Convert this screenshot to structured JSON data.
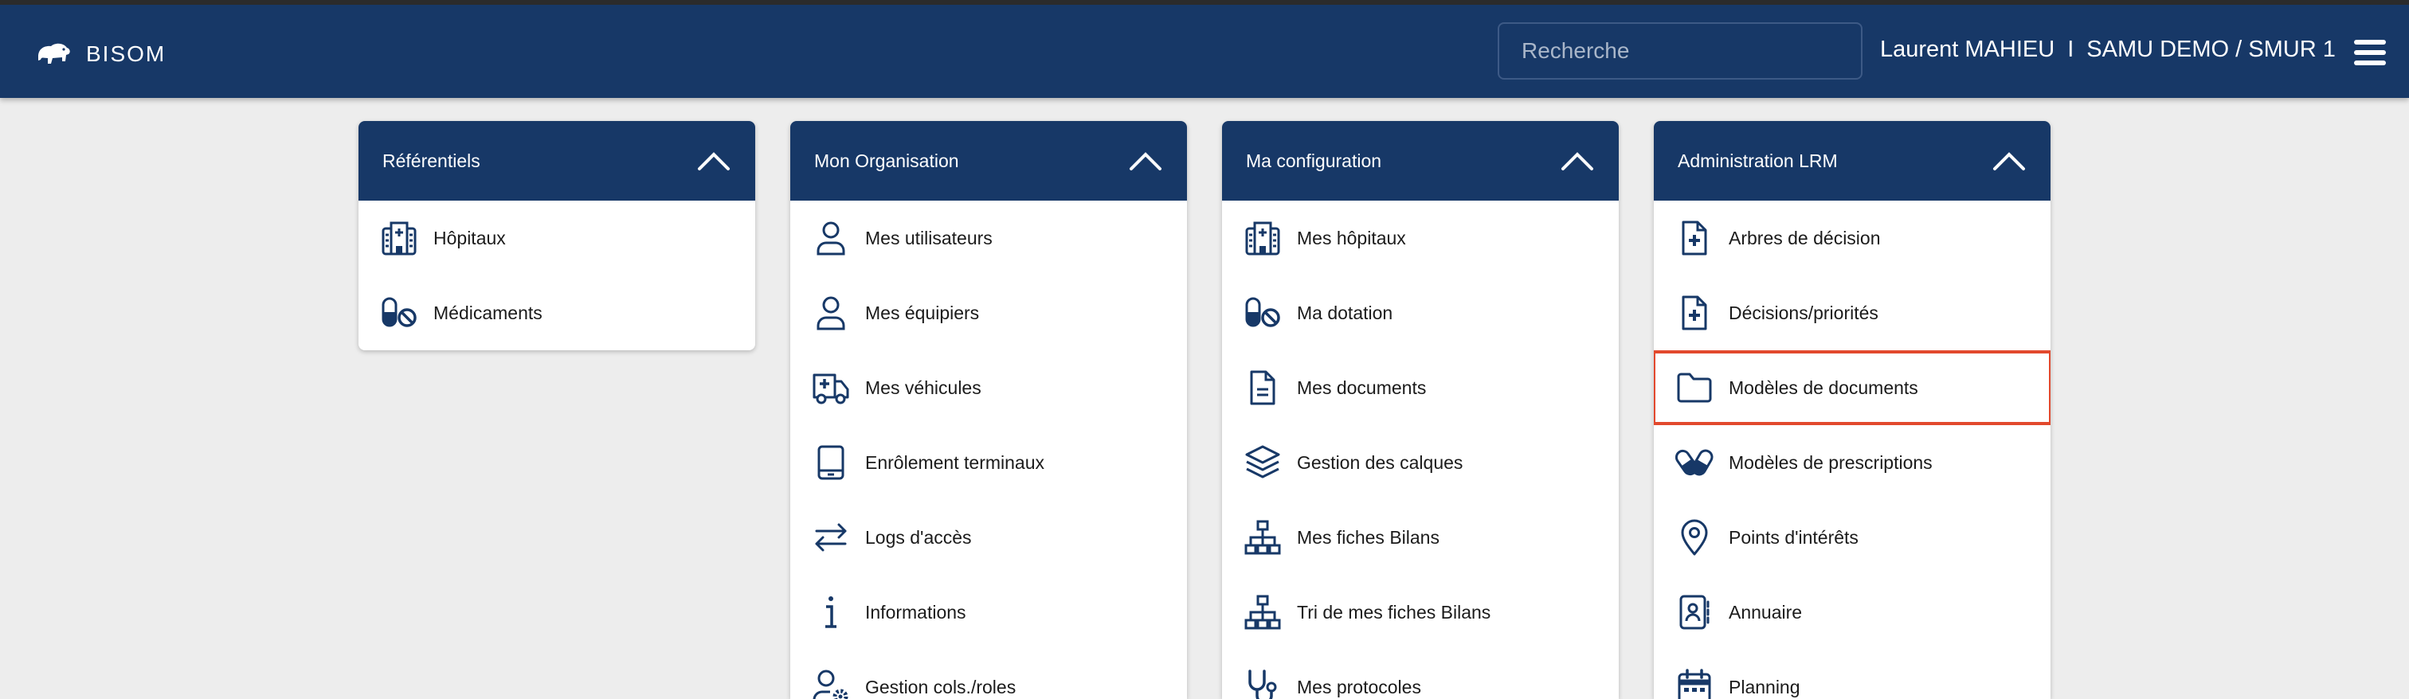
{
  "app": {
    "name": "BISOM"
  },
  "header": {
    "search_placeholder": "Recherche",
    "user_name": "Laurent MAHIEU",
    "separator": "I",
    "organization": "SAMU DEMO / SMUR 1"
  },
  "panels": [
    {
      "title": "Référentiels",
      "items": [
        {
          "label": "Hôpitaux",
          "icon": "hospital-icon"
        },
        {
          "label": "Médicaments",
          "icon": "pill-ban-icon"
        }
      ]
    },
    {
      "title": "Mon Organisation",
      "items": [
        {
          "label": "Mes utilisateurs",
          "icon": "user-icon"
        },
        {
          "label": "Mes équipiers",
          "icon": "user-icon"
        },
        {
          "label": "Mes véhicules",
          "icon": "ambulance-icon"
        },
        {
          "label": "Enrôlement terminaux",
          "icon": "tablet-icon"
        },
        {
          "label": "Logs d'accès",
          "icon": "exchange-arrows-icon"
        },
        {
          "label": "Informations",
          "icon": "info-icon"
        },
        {
          "label": "Gestion cols./roles",
          "icon": "user-gear-icon"
        }
      ]
    },
    {
      "title": "Ma configuration",
      "items": [
        {
          "label": "Mes hôpitaux",
          "icon": "hospital-icon"
        },
        {
          "label": "Ma dotation",
          "icon": "pill-ban-icon"
        },
        {
          "label": "Mes documents",
          "icon": "document-icon"
        },
        {
          "label": "Gestion des calques",
          "icon": "layers-icon"
        },
        {
          "label": "Mes fiches Bilans",
          "icon": "sitemap-icon"
        },
        {
          "label": "Tri de mes fiches Bilans",
          "icon": "sitemap-icon"
        },
        {
          "label": "Mes protocoles",
          "icon": "stethoscope-icon"
        }
      ]
    },
    {
      "title": "Administration LRM",
      "items": [
        {
          "label": "Arbres de décision",
          "icon": "file-medical-icon"
        },
        {
          "label": "Décisions/priorités",
          "icon": "file-medical-icon"
        },
        {
          "label": "Modèles de documents",
          "icon": "folder-icon"
        },
        {
          "label": "Modèles de prescriptions",
          "icon": "pills-icon"
        },
        {
          "label": "Points d'intérêts",
          "icon": "map-pin-icon"
        },
        {
          "label": "Annuaire",
          "icon": "address-book-icon"
        },
        {
          "label": "Planning",
          "icon": "calendar-icon"
        }
      ]
    }
  ],
  "colors": {
    "primary": "#173867",
    "background": "#ededed",
    "highlight": "#e2492d"
  }
}
